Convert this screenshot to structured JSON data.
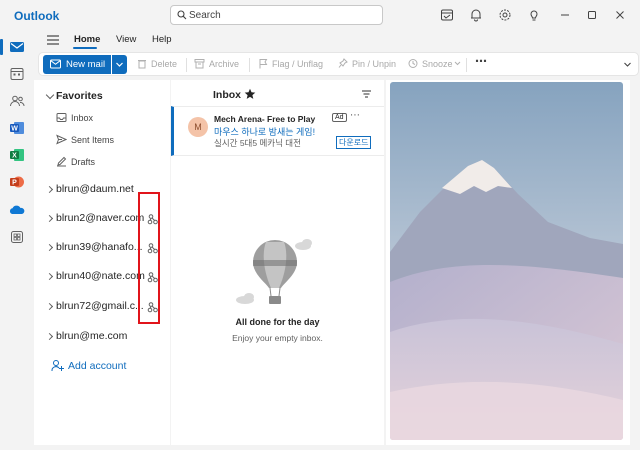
{
  "app": {
    "title": "Outlook"
  },
  "search": {
    "placeholder": "Search"
  },
  "ribbon": {
    "tabs": [
      {
        "label": "Home"
      },
      {
        "label": "View"
      },
      {
        "label": "Help"
      }
    ],
    "new_mail": "New mail",
    "delete": "Delete",
    "archive": "Archive",
    "flag": "Flag / Unflag",
    "pin": "Pin / Unpin",
    "snooze": "Snooze"
  },
  "folders": {
    "favorites_label": "Favorites",
    "items": [
      {
        "label": "Inbox"
      },
      {
        "label": "Sent Items"
      },
      {
        "label": "Drafts"
      }
    ],
    "accounts": [
      {
        "label": "blrun@daum.net"
      },
      {
        "label": "blrun2@naver.com"
      },
      {
        "label": "blrun39@hanafo..."
      },
      {
        "label": "blrun40@nate.com"
      },
      {
        "label": "blrun72@gmail.c..."
      },
      {
        "label": "blrun@me.com"
      }
    ],
    "add_account": "Add account"
  },
  "inbox": {
    "title": "Inbox",
    "ad": {
      "avatar": "M",
      "sender": "Mech Arena- Free to Play",
      "badge": "Ad",
      "subject": "마우스 하나로 밤새는 게임!",
      "preview": "실시간 5대5 메카닉 대전",
      "cta": "다운로드"
    },
    "empty_title": "All done for the day",
    "empty_sub": "Enjoy your empty inbox."
  },
  "colors": {
    "accent": "#0f6cbd",
    "highlight_box": "#e1141b"
  }
}
